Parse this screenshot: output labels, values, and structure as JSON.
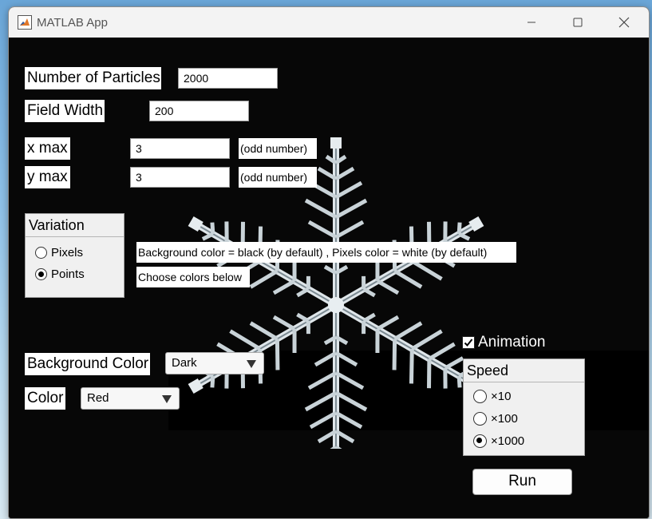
{
  "window": {
    "title": "MATLAB App",
    "icon": "matlab-logo-icon"
  },
  "titlebar_controls": [
    "minimize-icon",
    "maximize-icon",
    "close-icon"
  ],
  "fields": {
    "particles": {
      "label": "Number of Particles",
      "value": "2000"
    },
    "field_width": {
      "label": "Field Width",
      "value": "200"
    },
    "xmax": {
      "label": "x max",
      "value": "3",
      "hint": "(odd number)"
    },
    "ymax": {
      "label": "y max",
      "value": "3",
      "hint": "(odd number)"
    }
  },
  "variation": {
    "title": "Variation",
    "options": [
      "Pixels",
      "Points"
    ],
    "selected": "Points"
  },
  "info": {
    "line1": "Background color = black (by default) , Pixels color = white (by default)",
    "line2": "Choose colors below"
  },
  "background_color": {
    "label": "Background Color",
    "value": "Dark"
  },
  "color": {
    "label": "Color",
    "value": "Red"
  },
  "animation": {
    "label": "Animation",
    "checked": true
  },
  "speed": {
    "title": "Speed",
    "options": [
      "×10",
      "×100",
      "×1000"
    ],
    "selected": "×1000"
  },
  "run_label": "Run",
  "colors": {
    "canvas": "#070707",
    "panel": "#f0f0f0",
    "titlebar": "#f3f3f3"
  }
}
